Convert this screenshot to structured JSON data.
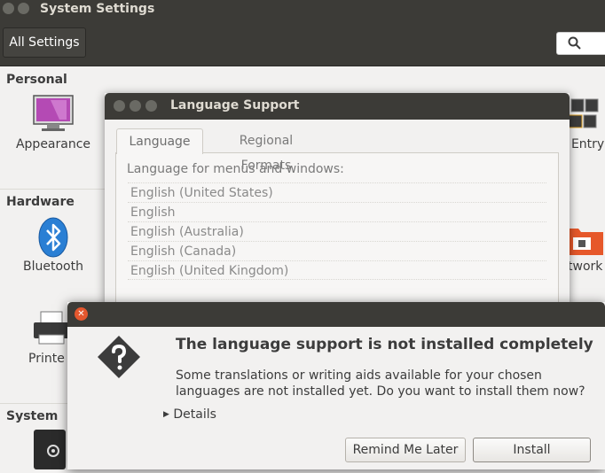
{
  "system_settings": {
    "title": "System Settings",
    "all_settings_label": "All Settings",
    "sections": {
      "personal": "Personal",
      "hardware": "Hardware",
      "system": "System"
    },
    "items": {
      "appearance": "Appearance",
      "bluetooth": "Bluetooth",
      "printers": "Printe",
      "text_entry": "t Entry",
      "network": "twork"
    }
  },
  "language_support": {
    "title": "Language Support",
    "tabs": [
      "Language",
      "Regional Formats"
    ],
    "caption": "Language for menus and windows:",
    "languages": [
      "English (United States)",
      "English",
      "English (Australia)",
      "English (Canada)",
      "English (United Kingdom)"
    ]
  },
  "alert": {
    "heading": "The language support is not installed completely",
    "body": "Some translations or writing aids available for your chosen languages are not installed yet. Do you want to install them now?",
    "details_label": "Details",
    "remind_label": "Remind Me Later",
    "install_label": "Install"
  },
  "icons": {
    "close": "close-icon",
    "search": "search-icon",
    "question": "question-icon"
  },
  "colors": {
    "titlebar": "#3c3b37",
    "close_button": "#e4572e",
    "appearance_icon": "#b44ab4",
    "bluetooth_icon": "#2a7fd4",
    "network_icon": "#e6582a"
  }
}
